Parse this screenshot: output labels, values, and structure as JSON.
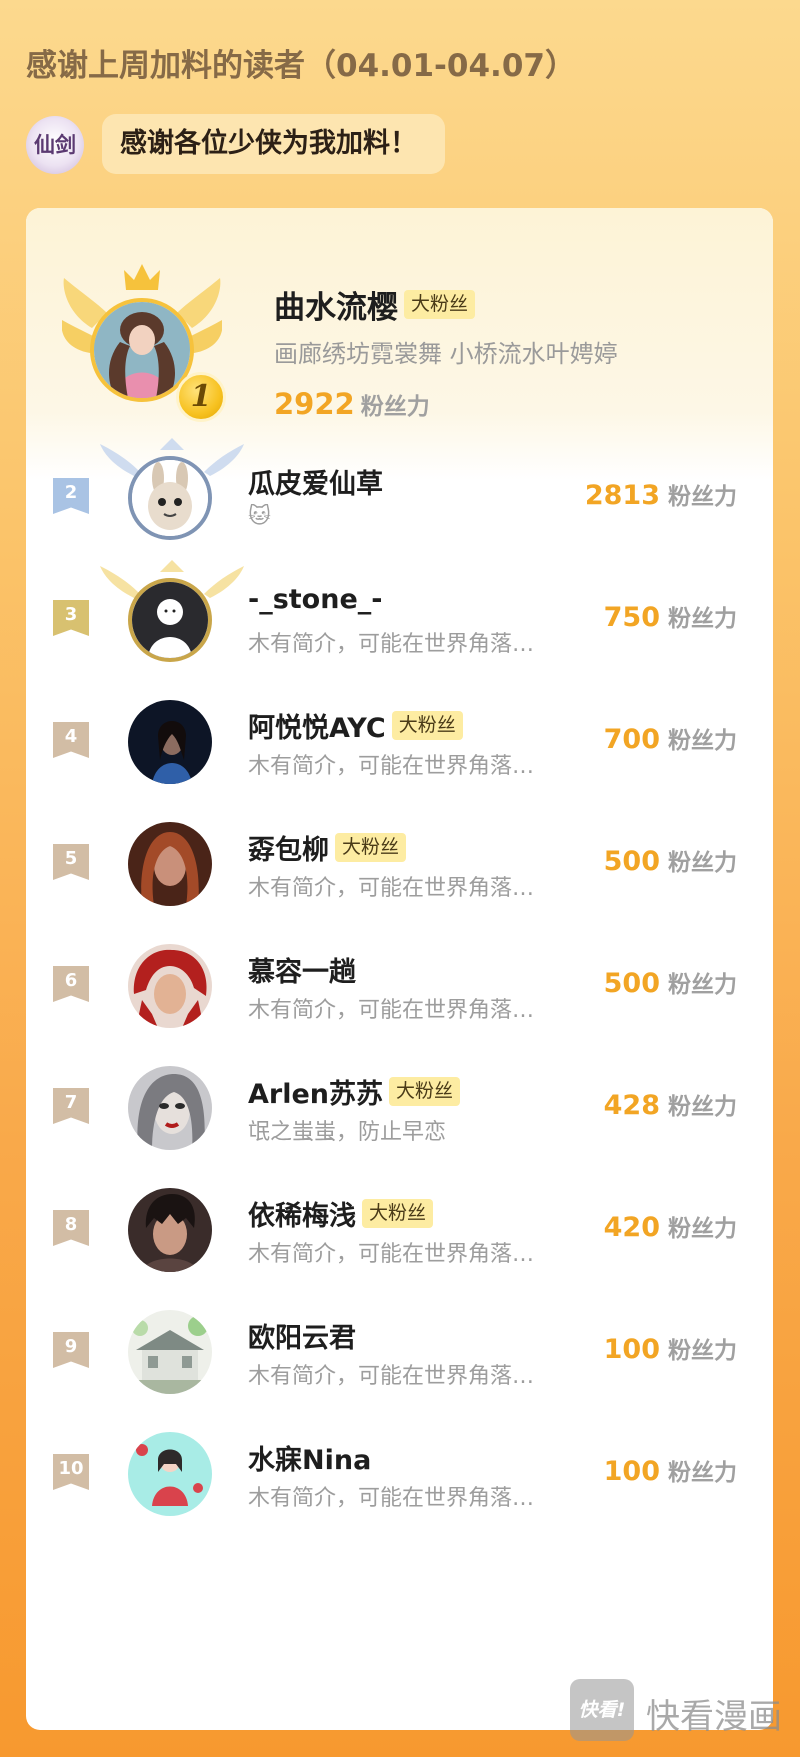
{
  "header": {
    "title": "感谢上周加料的读者（04.01-04.07）"
  },
  "host": {
    "avatar_text": "仙剑",
    "message": "感谢各位少侠为我加料！"
  },
  "top_fan": {
    "rank": "1",
    "name": "曲水流樱",
    "tag": "大粉丝",
    "bio": "画廊绣坊霓裳舞 小桥流水叶娉婷",
    "score": "2922",
    "unit": "粉丝力"
  },
  "fans": [
    {
      "rank": "2",
      "name": "瓜皮爱仙草",
      "tag": "",
      "bio": "🐱",
      "score": "2813",
      "unit": "粉丝力",
      "rank_color": "#a9c3e4"
    },
    {
      "rank": "3",
      "name": "-_stone_-",
      "tag": "",
      "bio": "木有简介，可能在世界角落里发呆",
      "score": "750",
      "unit": "粉丝力",
      "rank_color": "#d8c170"
    },
    {
      "rank": "4",
      "name": "阿悦悦AYC",
      "tag": "大粉丝",
      "bio": "木有简介，可能在世界角落里发呆",
      "score": "700",
      "unit": "粉丝力",
      "rank_color": "#d2bda5"
    },
    {
      "rank": "5",
      "name": "孬包柳",
      "tag": "大粉丝",
      "bio": "木有简介，可能在世界角落里发呆",
      "score": "500",
      "unit": "粉丝力",
      "rank_color": "#d2bda5"
    },
    {
      "rank": "6",
      "name": "慕容一趟",
      "tag": "",
      "bio": "木有简介，可能在世界角落里发呆",
      "score": "500",
      "unit": "粉丝力",
      "rank_color": "#d2bda5"
    },
    {
      "rank": "7",
      "name": "Arlen苏苏",
      "tag": "大粉丝",
      "bio": "氓之蚩蚩，防止早恋",
      "score": "428",
      "unit": "粉丝力",
      "rank_color": "#d2bda5"
    },
    {
      "rank": "8",
      "name": "依稀梅浅",
      "tag": "大粉丝",
      "bio": "木有简介，可能在世界角落里发呆",
      "score": "420",
      "unit": "粉丝力",
      "rank_color": "#d2bda5"
    },
    {
      "rank": "9",
      "name": "欧阳云君",
      "tag": "",
      "bio": "木有简介，可能在世界角落里发呆",
      "score": "100",
      "unit": "粉丝力",
      "rank_color": "#d2bda5"
    },
    {
      "rank": "10",
      "name": "水寐Nina",
      "tag": "",
      "bio": "木有简介，可能在世界角落里发呆",
      "score": "100",
      "unit": "粉丝力",
      "rank_color": "#d2bda5"
    }
  ],
  "watermark": {
    "logo": "快看!",
    "text": "快看漫画"
  }
}
